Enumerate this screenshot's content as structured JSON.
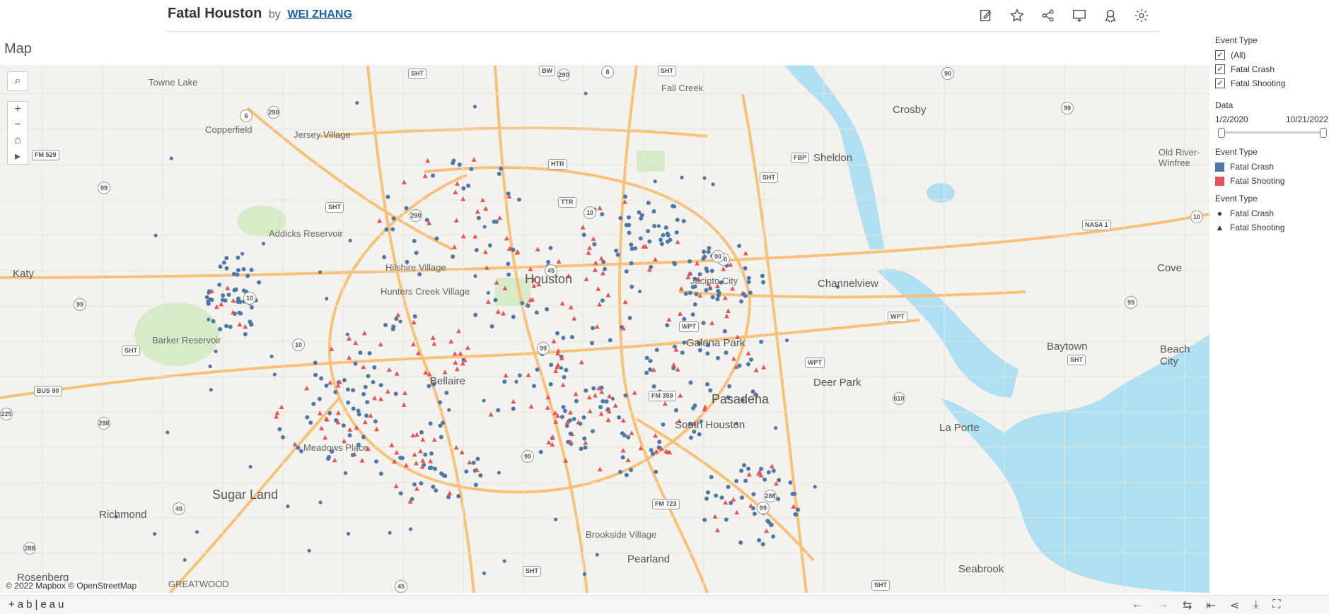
{
  "header": {
    "title": "Fatal Houston",
    "by": "by",
    "author": "WEI ZHANG"
  },
  "toolbar_icons": [
    "edit-icon",
    "favorite-star-icon",
    "share-icon",
    "comment-icon",
    "award-icon",
    "settings-gear-icon"
  ],
  "sheet_title": "Map",
  "map": {
    "attribution": "© 2022 Mapbox  © OpenStreetMap",
    "places": [
      {
        "name": "Towne Lake",
        "size": "small"
      },
      {
        "name": "Copperfield",
        "size": "small"
      },
      {
        "name": "Jersey Village",
        "size": "small"
      },
      {
        "name": "Fall Creek",
        "size": "small"
      },
      {
        "name": "Crosby",
        "size": "med"
      },
      {
        "name": "Sheldon",
        "size": "med"
      },
      {
        "name": "Old River-Winfree",
        "size": "small"
      },
      {
        "name": "Addicks Reservoir",
        "size": "small"
      },
      {
        "name": "Katy",
        "size": "med"
      },
      {
        "name": "Hilshire Village",
        "size": "small"
      },
      {
        "name": "Hunters Creek Village",
        "size": "small"
      },
      {
        "name": "Houston",
        "size": "big"
      },
      {
        "name": "Jacinto City",
        "size": "small"
      },
      {
        "name": "Channelview",
        "size": "med"
      },
      {
        "name": "Cove",
        "size": "med"
      },
      {
        "name": "Barker Reservoir",
        "size": "small"
      },
      {
        "name": "Galena Park",
        "size": "med"
      },
      {
        "name": "Baytown",
        "size": "med"
      },
      {
        "name": "Beach City",
        "size": "med"
      },
      {
        "name": "Bellaire",
        "size": "med"
      },
      {
        "name": "Deer Park",
        "size": "med"
      },
      {
        "name": "Pasadena",
        "size": "big"
      },
      {
        "name": "South Houston",
        "size": "med"
      },
      {
        "name": "La Porte",
        "size": "med"
      },
      {
        "name": "Meadows Place",
        "size": "small"
      },
      {
        "name": "Sugar Land",
        "size": "big"
      },
      {
        "name": "Richmond",
        "size": "med"
      },
      {
        "name": "Brookside Village",
        "size": "small"
      },
      {
        "name": "Pearland",
        "size": "med"
      },
      {
        "name": "Seabrook",
        "size": "med"
      },
      {
        "name": "Rosenberg",
        "size": "med"
      },
      {
        "name": "GREATWOOD",
        "size": "small"
      }
    ],
    "shields": [
      "SHT",
      "290",
      "BW",
      "8",
      "SHT",
      "90",
      "6",
      "290",
      "FM 529",
      "99",
      "HTR",
      "SHT",
      "90",
      "99",
      "SHT",
      "290",
      "TTR",
      "10",
      "99",
      "10",
      "45",
      "90",
      "99",
      "10",
      "WPT",
      "WPT",
      "WPT",
      "610",
      "SHT",
      "225",
      "99",
      "FM 359",
      "288",
      "45",
      "99",
      "99",
      "288",
      "SHT",
      "45",
      "SHT",
      "FM 723",
      "288",
      "FBP",
      "NASA 1",
      "SHT",
      "10",
      "BUS 90"
    ]
  },
  "legend": {
    "filter_title": "Event Type",
    "filter_items": [
      {
        "label": "(All)",
        "checked": true
      },
      {
        "label": "Fatal Crash",
        "checked": true
      },
      {
        "label": "Fatal Shooting",
        "checked": true
      }
    ],
    "date_title": "Data",
    "date_start": "1/2/2020",
    "date_end": "10/21/2022",
    "color_title": "Event Type",
    "color_items": [
      {
        "label": "Fatal Crash",
        "color": "#4e79a7"
      },
      {
        "label": "Fatal Shooting",
        "color": "#e15759"
      }
    ],
    "shape_title": "Event Type",
    "shape_items": [
      {
        "label": "Fatal Crash",
        "shape": "circle"
      },
      {
        "label": "Fatal Shooting",
        "shape": "triangle"
      }
    ]
  },
  "footer": {
    "brand": "+ab|eau",
    "nav_icons": [
      "undo-icon",
      "redo-icon",
      "revert-icon",
      "reset-icon",
      "share-icon",
      "download-icon",
      "fullscreen-icon"
    ]
  },
  "colors": {
    "crash": "#4e79a7",
    "shooting": "#e15759",
    "water": "#aedff2",
    "road": "#f7c17a",
    "park": "#d6ebc8"
  }
}
